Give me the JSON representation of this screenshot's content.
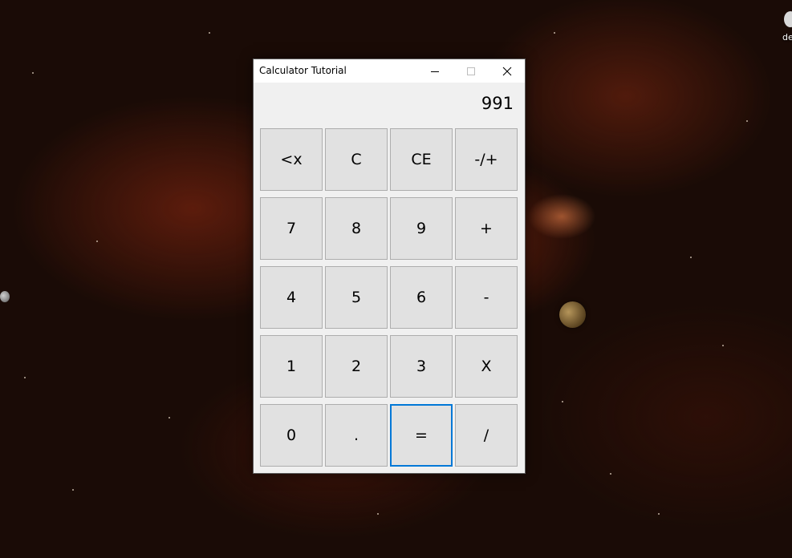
{
  "desktop": {
    "icon_label": "de"
  },
  "window": {
    "title": "Calculator Tutorial",
    "controls": {
      "minimize": "minimize-icon",
      "maximize": "maximize-icon",
      "close": "close-icon"
    }
  },
  "display": {
    "value": "991"
  },
  "keys": {
    "backspace": "<x",
    "clear": "C",
    "clear_entry": "CE",
    "negate": "-/+",
    "seven": "7",
    "eight": "8",
    "nine": "9",
    "plus": "+",
    "four": "4",
    "five": "5",
    "six": "6",
    "minus": "-",
    "one": "1",
    "two": "2",
    "three": "3",
    "multiply": "X",
    "zero": "0",
    "decimal": ".",
    "equals": "=",
    "divide": "/"
  },
  "colors": {
    "focus_border": "#0078d7",
    "key_background": "#e1e1e1",
    "window_background": "#f0f0f0"
  }
}
